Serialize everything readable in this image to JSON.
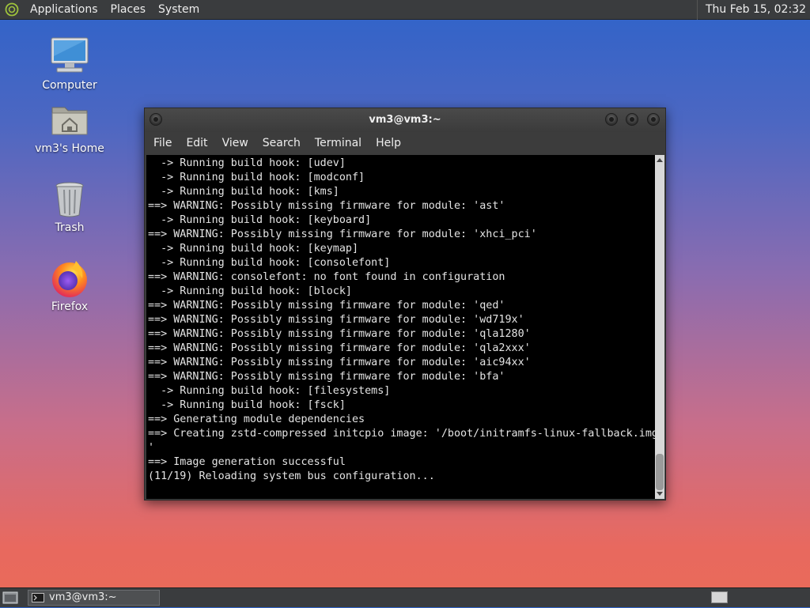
{
  "top_panel": {
    "menu": [
      "Applications",
      "Places",
      "System"
    ],
    "clock": "Thu Feb 15, 02:32"
  },
  "desktop_icons": [
    {
      "label": "Computer",
      "icon": "computer-icon"
    },
    {
      "label": "vm3's Home",
      "icon": "home-folder-icon"
    },
    {
      "label": "Trash",
      "icon": "trash-icon"
    },
    {
      "label": "Firefox",
      "icon": "firefox-icon"
    }
  ],
  "terminal": {
    "title": "vm3@vm3:~",
    "menu": [
      "File",
      "Edit",
      "View",
      "Search",
      "Terminal",
      "Help"
    ],
    "lines": [
      "  -> Running build hook: [udev]",
      "  -> Running build hook: [modconf]",
      "  -> Running build hook: [kms]",
      "==> WARNING: Possibly missing firmware for module: 'ast'",
      "  -> Running build hook: [keyboard]",
      "==> WARNING: Possibly missing firmware for module: 'xhci_pci'",
      "  -> Running build hook: [keymap]",
      "  -> Running build hook: [consolefont]",
      "==> WARNING: consolefont: no font found in configuration",
      "  -> Running build hook: [block]",
      "==> WARNING: Possibly missing firmware for module: 'qed'",
      "==> WARNING: Possibly missing firmware for module: 'wd719x'",
      "==> WARNING: Possibly missing firmware for module: 'qla1280'",
      "==> WARNING: Possibly missing firmware for module: 'qla2xxx'",
      "==> WARNING: Possibly missing firmware for module: 'aic94xx'",
      "==> WARNING: Possibly missing firmware for module: 'bfa'",
      "  -> Running build hook: [filesystems]",
      "  -> Running build hook: [fsck]",
      "==> Generating module dependencies",
      "==> Creating zstd-compressed initcpio image: '/boot/initramfs-linux-fallback.img",
      "'",
      "==> Image generation successful",
      "(11/19) Reloading system bus configuration..."
    ]
  },
  "taskbar": {
    "task_label": "vm3@vm3:~"
  }
}
